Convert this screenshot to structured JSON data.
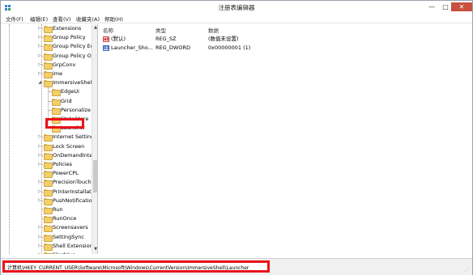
{
  "window": {
    "title": "注册表编辑器",
    "controls": {
      "minimize": "—",
      "maximize": "□",
      "close": "✕"
    }
  },
  "menu": [
    "文件(F)",
    "编辑(E)",
    "查看(V)",
    "收藏夹(A)",
    "帮助(H)"
  ],
  "tree": {
    "items": [
      {
        "label": "Extensions",
        "level": 0,
        "arrow": "▷"
      },
      {
        "label": "Group Policy",
        "level": 0,
        "arrow": "▷"
      },
      {
        "label": "Group Policy Ed",
        "level": 0,
        "arrow": "▷"
      },
      {
        "label": "Group Policy O",
        "level": 0,
        "arrow": "▷"
      },
      {
        "label": "GrpConv",
        "level": 0,
        "arrow": "▷"
      },
      {
        "label": "ime",
        "level": 0,
        "arrow": "▷"
      },
      {
        "label": "ImmersiveShell",
        "level": 0,
        "arrow": "◢"
      },
      {
        "label": "EdgeUi",
        "level": 1,
        "arrow": ""
      },
      {
        "label": "Grid",
        "level": 1,
        "arrow": ""
      },
      {
        "label": "Personalize",
        "level": 1,
        "arrow": ""
      },
      {
        "label": "StateStore",
        "level": 1,
        "arrow": ""
      },
      {
        "label": "Launcher",
        "level": 1,
        "arrow": ""
      },
      {
        "label": "Internet Setting",
        "level": 0,
        "arrow": "▷"
      },
      {
        "label": "Lock Screen",
        "level": 0,
        "arrow": "▷"
      },
      {
        "label": "OnDemandInte",
        "level": 0,
        "arrow": "▷"
      },
      {
        "label": "Policies",
        "level": 0,
        "arrow": "▷"
      },
      {
        "label": "PowerCPL",
        "level": 0,
        "arrow": ""
      },
      {
        "label": "PrecisionTouchi",
        "level": 0,
        "arrow": "▷"
      },
      {
        "label": "PrinterInstallati",
        "level": 0,
        "arrow": "▷"
      },
      {
        "label": "PushNotification",
        "level": 0,
        "arrow": "▷"
      },
      {
        "label": "Run",
        "level": 0,
        "arrow": ""
      },
      {
        "label": "RunOnce",
        "level": 0,
        "arrow": ""
      },
      {
        "label": "Screensavers",
        "level": 0,
        "arrow": "▷"
      },
      {
        "label": "SettingSync",
        "level": 0,
        "arrow": "▷"
      },
      {
        "label": "Shell Extensions",
        "level": 0,
        "arrow": "▷"
      },
      {
        "label": "Skydrive",
        "level": 0,
        "arrow": "▷"
      }
    ],
    "selected": "Launcher"
  },
  "values": {
    "headers": {
      "name": "名称",
      "type": "类型",
      "data": "数据"
    },
    "rows": [
      {
        "icon": "ab",
        "name": "(默认)",
        "type": "REG_SZ",
        "data": "(数值未设置)"
      },
      {
        "icon": "01",
        "name": "Launcher_Sho...",
        "type": "REG_DWORD",
        "data": "0x00000001 (1)"
      }
    ]
  },
  "status": {
    "path": "计算机\\HKEY_CURRENT_USER\\Software\\Microsoft\\Windows\\CurrentVersion\\ImmersiveShell\\Launcher"
  },
  "colors": {
    "highlight": "#e8141b",
    "folder": "#f2cf6b"
  }
}
